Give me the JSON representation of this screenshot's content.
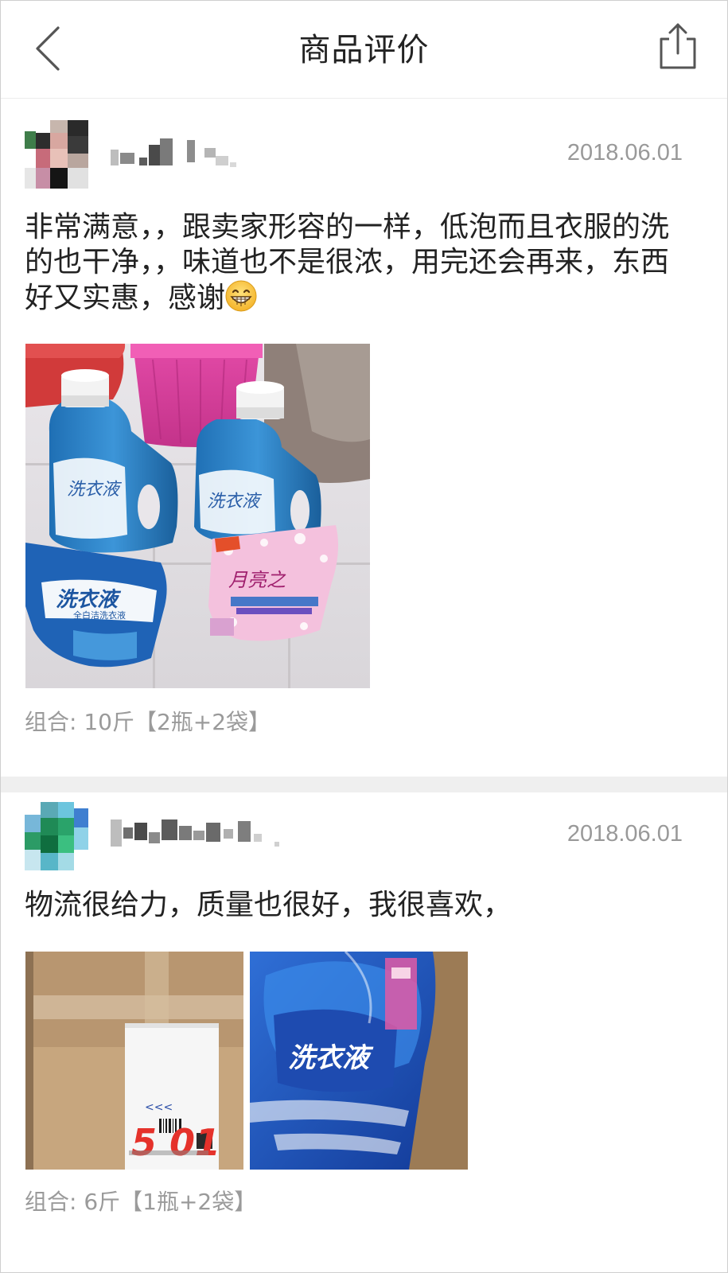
{
  "header": {
    "title": "商品评价",
    "back_icon": "chevron-left-icon",
    "share_icon": "share-icon"
  },
  "reviews": [
    {
      "date": "2018.06.01",
      "text_before_emoji": "非常满意，，跟卖家形容的一样，低泡而且衣服的洗的也干净，，味道也不是很浓，用完还会再来，东西好又实惠，感谢",
      "emoji": "grinning-face-emoji",
      "combo": "组合: 10斤【2瓶+2袋】",
      "photo_labels": {
        "bottle_label": "洗衣液",
        "pouch_label_blue": "洗衣液",
        "pouch_sub_blue": "全白洁洗衣液",
        "pouch_label_pink": "月亮之"
      }
    },
    {
      "date": "2018.06.01",
      "text": "物流很给力，质量也很好，我很喜欢，",
      "combo": "组合: 6斤【1瓶+2袋】",
      "photo_labels": {
        "box_label": "5 01",
        "bag_label": "洗衣液"
      }
    }
  ],
  "colors": {
    "divider": "#efefef",
    "muted_text": "#999999",
    "body_text": "#222222"
  }
}
